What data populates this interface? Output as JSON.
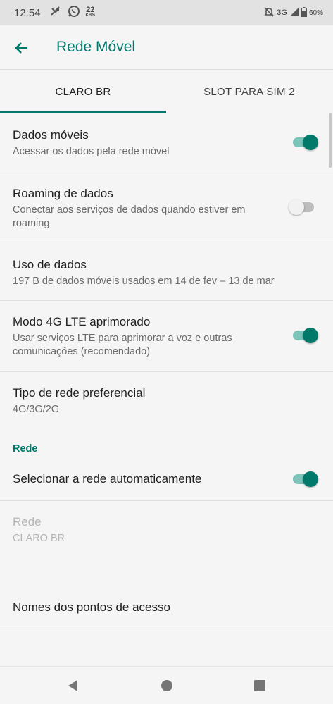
{
  "status_bar": {
    "time": "12:54",
    "data_speed": "22",
    "data_speed_unit": "KB/s",
    "network": "3G",
    "battery": "60%",
    "icons": [
      "missed-call-icon",
      "whatsapp-icon",
      "mute-icon",
      "signal-icon",
      "battery-icon"
    ]
  },
  "app_bar": {
    "title": "Rede Móvel",
    "back_icon": "arrow-back-icon"
  },
  "tabs": [
    {
      "label": "CLARO BR",
      "selected": true
    },
    {
      "label": "SLOT PARA SIM 2",
      "selected": false
    }
  ],
  "settings": [
    {
      "title": "Dados móveis",
      "summary": "Acessar os dados pela rede móvel",
      "toggle": true
    },
    {
      "title": "Roaming de dados",
      "summary_lines": [
        "Conectar aos serviços de dados quando estiver em",
        "roaming"
      ],
      "toggle": false
    },
    {
      "title": "Uso de dados",
      "summary": "197 B de dados móveis usados em 14 de fev – 13 de mar"
    },
    {
      "title": "Modo 4G LTE aprimorado",
      "summary_lines": [
        "Usar serviços LTE para aprimorar a voz e outras",
        "comunicações (recomendado)"
      ],
      "toggle": true
    },
    {
      "title": "Tipo de rede preferencial",
      "summary": "4G/3G/2G"
    }
  ],
  "network_section": {
    "header": "Rede",
    "items": [
      {
        "title": "Selecionar a rede automaticamente",
        "toggle": true
      },
      {
        "title": "Rede",
        "summary": "CLARO BR",
        "enabled": false
      },
      {
        "title": "Nomes dos pontos de acesso"
      }
    ]
  },
  "colors": {
    "accent": "#00796b",
    "switch_track_on": "#7cc4b9"
  },
  "nav_bar": {
    "icons": [
      "back-icon",
      "home-icon",
      "recents-icon"
    ]
  }
}
